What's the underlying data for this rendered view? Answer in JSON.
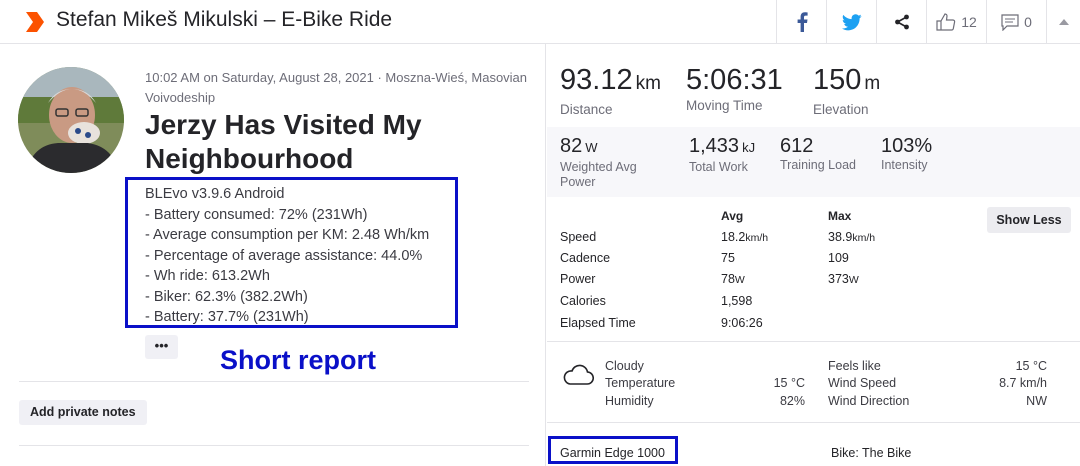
{
  "header": {
    "title": "Stefan Mikeš Mikulski – E-Bike Ride",
    "kudos_count": "12",
    "comment_count": "0",
    "brand_color": "#fc5200"
  },
  "activity": {
    "meta": "10:02 AM on Saturday, August 28, 2021 · Moszna-Wieś, Masovian Voivodeship",
    "name": "Jerzy Has Visited My Neighbourhood",
    "report": "BLEvo v3.9.6 Android\n- Battery consumed: 72% (231Wh)\n- Average consumption per KM: 2.48 Wh/km\n- Percentage of average assistance: 44.0%\n- Wh ride: 613.2Wh\n- Biker: 62.3% (382.2Wh)\n- Battery: 37.7% (231Wh)",
    "more_label": "•••",
    "private_notes_label": "Add private notes"
  },
  "annotations": {
    "short_report": "Short report",
    "color": "#0a10c8"
  },
  "stats": {
    "distance": {
      "value": "93.12",
      "unit": "km",
      "label": "Distance"
    },
    "moving_time": {
      "value": "5:06:31",
      "label": "Moving Time"
    },
    "elevation": {
      "value": "150",
      "unit": "m",
      "label": "Elevation"
    },
    "weighted_power": {
      "value": "82",
      "unit": "W",
      "label": "Weighted Avg Power"
    },
    "total_work": {
      "value": "1,433",
      "unit": "kJ",
      "label": "Total Work"
    },
    "training_load": {
      "value": "612",
      "label": "Training Load"
    },
    "intensity": {
      "value": "103%",
      "label": "Intensity"
    }
  },
  "table": {
    "col_avg": "Avg",
    "col_max": "Max",
    "show_less": "Show Less",
    "rows": [
      {
        "label": "Speed",
        "avg": "18.2",
        "avg_unit": "km/h",
        "max": "38.9",
        "max_unit": "km/h"
      },
      {
        "label": "Cadence",
        "avg": "75",
        "avg_unit": "",
        "max": "109",
        "max_unit": ""
      },
      {
        "label": "Power",
        "avg": "78",
        "avg_unit": "W",
        "max": "373",
        "max_unit": "W"
      },
      {
        "label": "Calories",
        "avg": "1,598",
        "avg_unit": "",
        "max": "",
        "max_unit": ""
      },
      {
        "label": "Elapsed Time",
        "avg": "9:06:26",
        "avg_unit": "",
        "max": "",
        "max_unit": ""
      }
    ]
  },
  "weather": {
    "condition": "Cloudy",
    "temperature_label": "Temperature",
    "temperature": "15 °C",
    "humidity_label": "Humidity",
    "humidity": "82%",
    "feels_like_label": "Feels like",
    "feels_like": "15 °C",
    "wind_speed_label": "Wind Speed",
    "wind_speed": "8.7 km/h",
    "wind_direction_label": "Wind Direction",
    "wind_direction": "NW"
  },
  "device": "Garmin Edge 1000",
  "bike": "Bike: The Bike"
}
